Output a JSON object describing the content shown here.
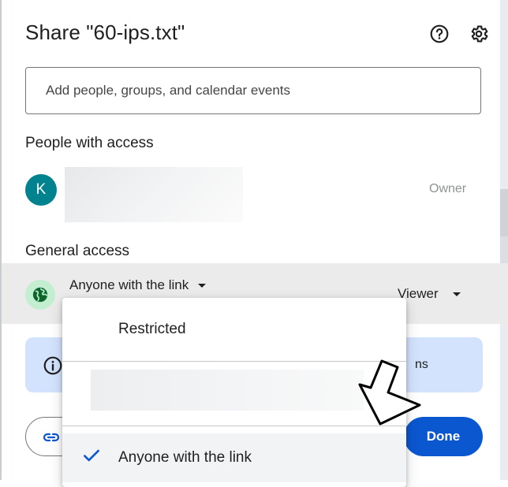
{
  "dialog": {
    "title": "Share \"60-ips.txt\"",
    "help_icon": "help-circle-icon",
    "settings_icon": "gear-icon"
  },
  "search": {
    "placeholder": "Add people, groups, and calendar events"
  },
  "people": {
    "section_title": "People with access",
    "owner": {
      "avatar_initial": "K",
      "avatar_color": "#00838f",
      "role": "Owner"
    }
  },
  "general_access": {
    "section_title": "General access",
    "access_level": "Anyone with the link",
    "role": "Viewer",
    "globe_icon": "globe-icon"
  },
  "info_banner": {
    "visible_text_tail": "ns",
    "icon": "info-icon"
  },
  "footer": {
    "copy_link_icon": "link-icon",
    "done_label": "Done",
    "done_color": "#0b57d0"
  },
  "dropdown": {
    "items": [
      {
        "label": "Restricted",
        "selected": false
      },
      {
        "label": "Anyone with the link",
        "selected": true
      }
    ],
    "check_color": "#0b57d0"
  }
}
